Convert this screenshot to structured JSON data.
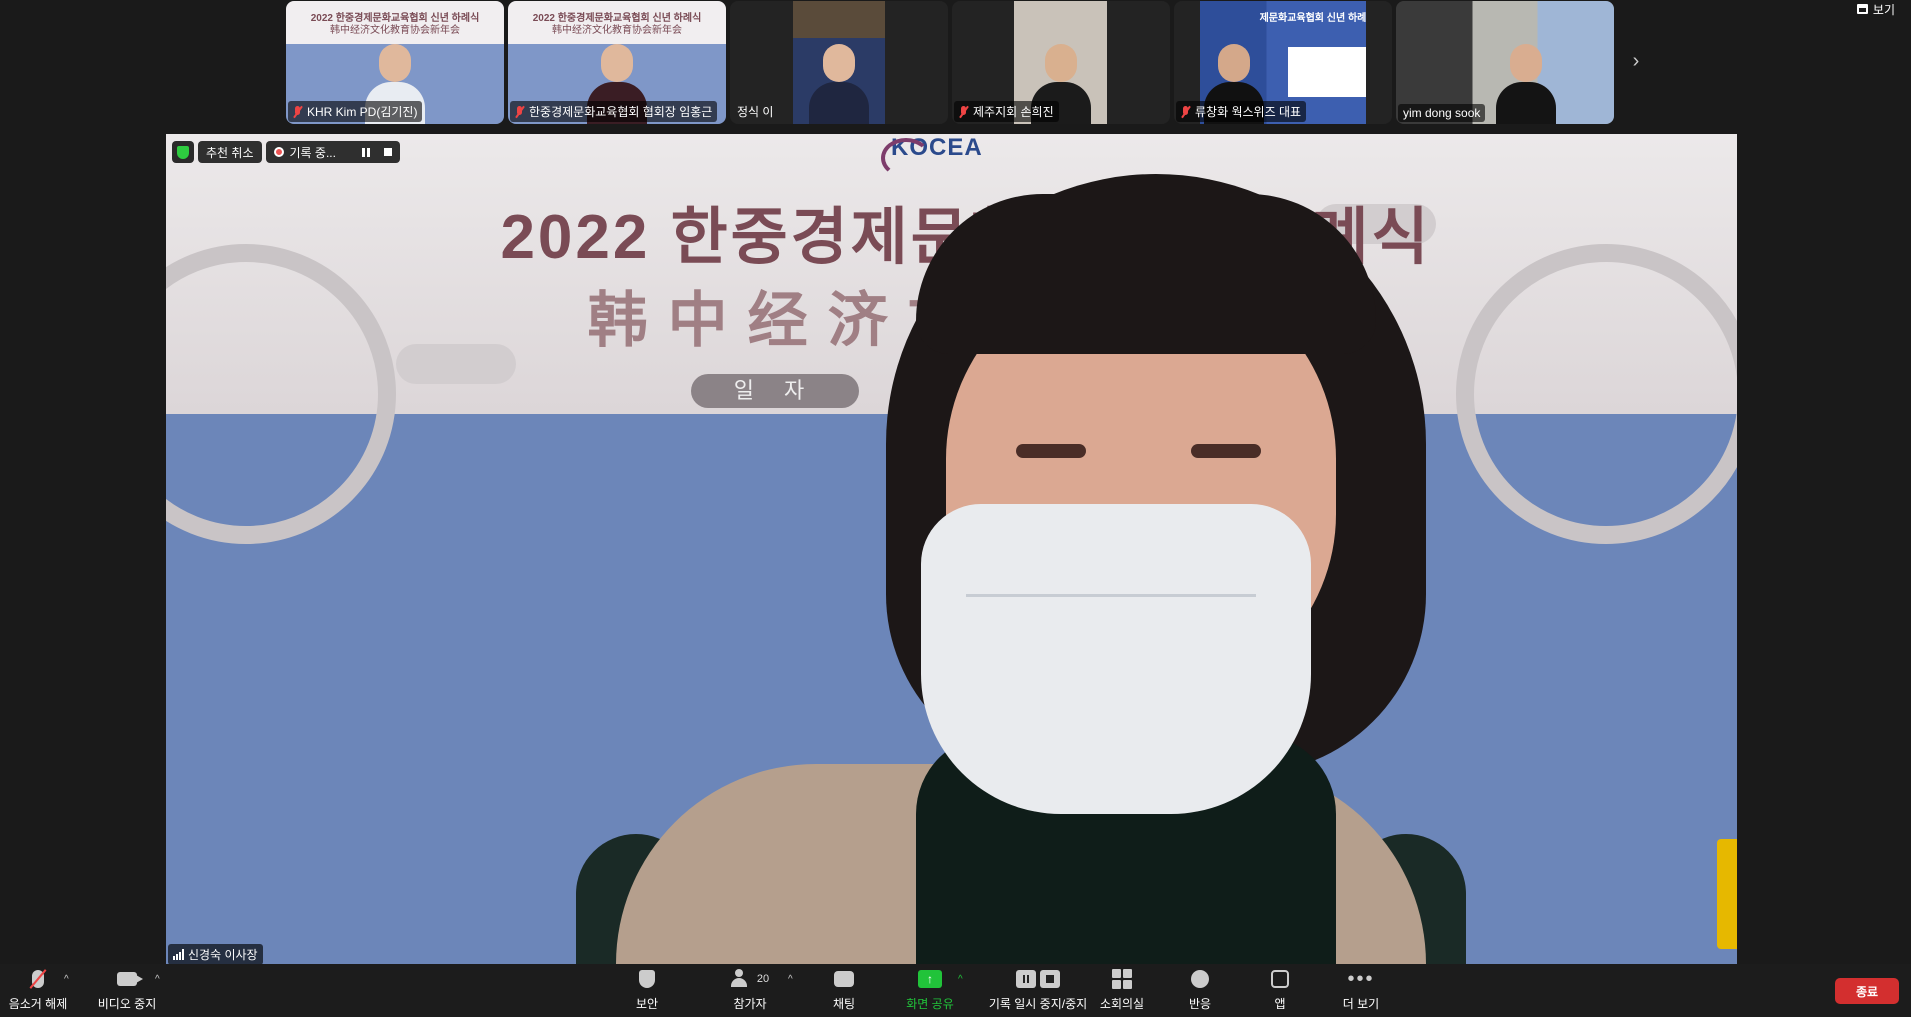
{
  "strip": {
    "participants": [
      {
        "name": "KHR Kim PD(김기진)",
        "muted": true,
        "banner_title": "2022 한중경제문화교육협회 신년 하례식",
        "banner_sub": "韩中经济文化教育协会新年会"
      },
      {
        "name": "한중경제문화교육협회 협회장 임홍근",
        "muted": true,
        "banner_title": "2022 한중경제문화교육협회 신년 하례식",
        "banner_sub": "韩中经济文化教育协会新年会"
      },
      {
        "name": "정식 이",
        "muted": false
      },
      {
        "name": "제주지회 손희진",
        "muted": true
      },
      {
        "name": "류창화 웍스위즈 대표",
        "muted": true,
        "banner_title": "제문화교육협회 신년 하례"
      },
      {
        "name": "yim dong sook",
        "muted": false
      }
    ],
    "next_icon": "chevron-right-icon",
    "view_label": "보기"
  },
  "main": {
    "banner": {
      "logo": "KOCEA",
      "title": "2022 한중경제문화교육협회 신년 하례식",
      "title_visible": "2022 한중경제문화교   신년 하례식",
      "chinese": "韩中经济文化   新年会",
      "date_label": "일 자"
    },
    "recording": {
      "cancel_recommend": "추천 취소",
      "recording_label": "기록 중..."
    },
    "speaker_name": "신경숙 이사장"
  },
  "toolbar": {
    "unmute": "음소거 해제",
    "stop_video": "비디오 중지",
    "security": "보안",
    "participants": "참가자",
    "participants_count": "20",
    "chat": "채팅",
    "share_screen": "화면 공유",
    "record": "기록 일시 중지/중지",
    "breakout": "소회의실",
    "reactions": "반응",
    "apps": "앱",
    "more": "더 보기",
    "end": "종료"
  },
  "colors": {
    "share_green": "#21c33a",
    "end_red": "#d32f2f",
    "muted_red": "#e44444",
    "banner_text": "#7a4b55"
  }
}
